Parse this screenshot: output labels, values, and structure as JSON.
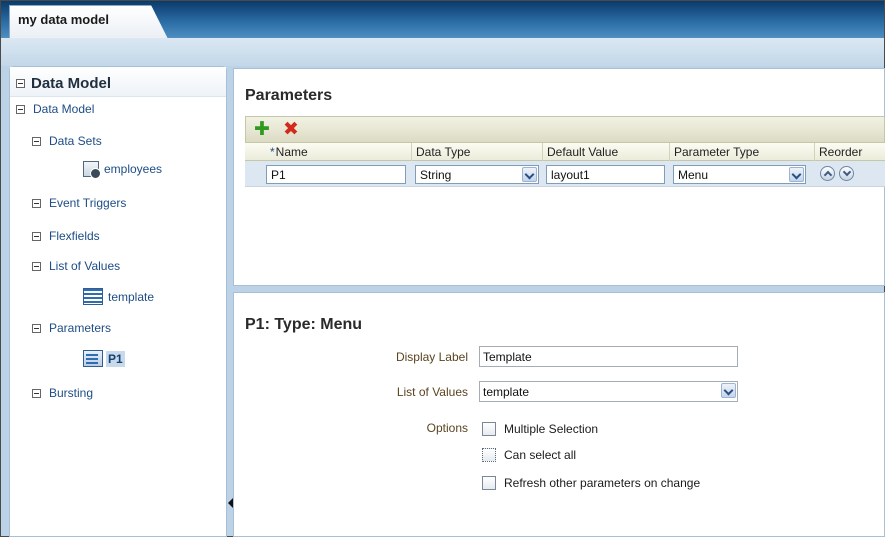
{
  "tab": {
    "title": "my data model"
  },
  "sidebar": {
    "header": "Data Model",
    "items": [
      {
        "label": "Data Model",
        "kind": "node"
      },
      {
        "label": "Data Sets",
        "kind": "node"
      },
      {
        "label": "employees",
        "kind": "data-set",
        "icon": "data-set-icon"
      },
      {
        "label": "Event Triggers",
        "kind": "node"
      },
      {
        "label": "Flexfields",
        "kind": "node"
      },
      {
        "label": "List of Values",
        "kind": "node"
      },
      {
        "label": "template",
        "kind": "lov",
        "icon": "list-of-values-icon"
      },
      {
        "label": "Parameters",
        "kind": "node"
      },
      {
        "label": "P1",
        "kind": "parameter",
        "icon": "parameter-icon",
        "selected": true
      },
      {
        "label": "Bursting",
        "kind": "node"
      }
    ]
  },
  "parameters": {
    "title": "Parameters",
    "toolbar": {
      "add_icon": "add-icon",
      "delete_icon": "delete-icon"
    },
    "columns": {
      "required_marker": "*",
      "name": "Name",
      "data_type": "Data Type",
      "default_value": "Default Value",
      "parameter_type": "Parameter Type",
      "reorder": "Reorder"
    },
    "rows": [
      {
        "name": "P1",
        "data_type": "String",
        "default_value": "layout1",
        "parameter_type": "Menu"
      }
    ]
  },
  "detail": {
    "title": "P1: Type: Menu",
    "display_label": {
      "label": "Display Label",
      "value": "Template"
    },
    "list_of_values": {
      "label": "List of Values",
      "value": "template"
    },
    "options": {
      "label": "Options",
      "multiple_selection": "Multiple Selection",
      "can_select_all": "Can select all",
      "refresh_other": "Refresh other parameters on change"
    }
  },
  "colors": {
    "tab_strip": "#0a3a6a",
    "tree_link": "#1d4d86",
    "add": "#2e9a22",
    "delete": "#d22a1c",
    "form_label": "#5a4420"
  }
}
